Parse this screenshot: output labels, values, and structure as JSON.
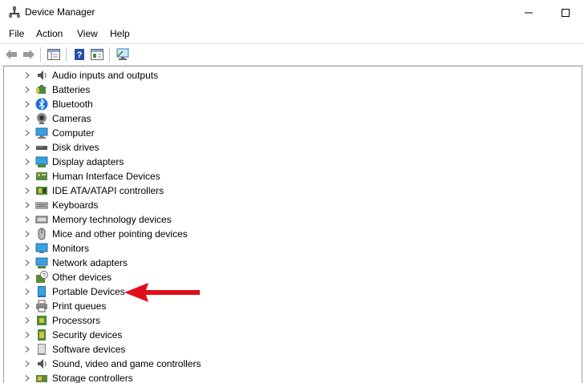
{
  "window": {
    "title": "Device Manager"
  },
  "menu": {
    "file": "File",
    "action": "Action",
    "view": "View",
    "help": "Help"
  },
  "tree": [
    {
      "label": "Audio inputs and outputs",
      "icon": "speaker-icon"
    },
    {
      "label": "Batteries",
      "icon": "battery-icon"
    },
    {
      "label": "Bluetooth",
      "icon": "bluetooth-icon"
    },
    {
      "label": "Cameras",
      "icon": "camera-icon"
    },
    {
      "label": "Computer",
      "icon": "computer-icon"
    },
    {
      "label": "Disk drives",
      "icon": "disk-drive-icon"
    },
    {
      "label": "Display adapters",
      "icon": "display-adapter-icon"
    },
    {
      "label": "Human Interface Devices",
      "icon": "hid-icon"
    },
    {
      "label": "IDE ATA/ATAPI controllers",
      "icon": "ide-controller-icon"
    },
    {
      "label": "Keyboards",
      "icon": "keyboard-icon"
    },
    {
      "label": "Memory technology devices",
      "icon": "memory-icon"
    },
    {
      "label": "Mice and other pointing devices",
      "icon": "mouse-icon"
    },
    {
      "label": "Monitors",
      "icon": "monitor-icon"
    },
    {
      "label": "Network adapters",
      "icon": "network-adapter-icon"
    },
    {
      "label": "Other devices",
      "icon": "other-devices-icon"
    },
    {
      "label": "Portable Devices",
      "icon": "portable-device-icon"
    },
    {
      "label": "Print queues",
      "icon": "printer-icon"
    },
    {
      "label": "Processors",
      "icon": "processor-icon"
    },
    {
      "label": "Security devices",
      "icon": "security-device-icon"
    },
    {
      "label": "Software devices",
      "icon": "software-device-icon"
    },
    {
      "label": "Sound, video and game controllers",
      "icon": "sound-controller-icon"
    },
    {
      "label": "Storage controllers",
      "icon": "storage-controller-icon"
    }
  ],
  "annotation": {
    "arrow_color": "#e0101a",
    "points_to": "Portable Devices"
  }
}
